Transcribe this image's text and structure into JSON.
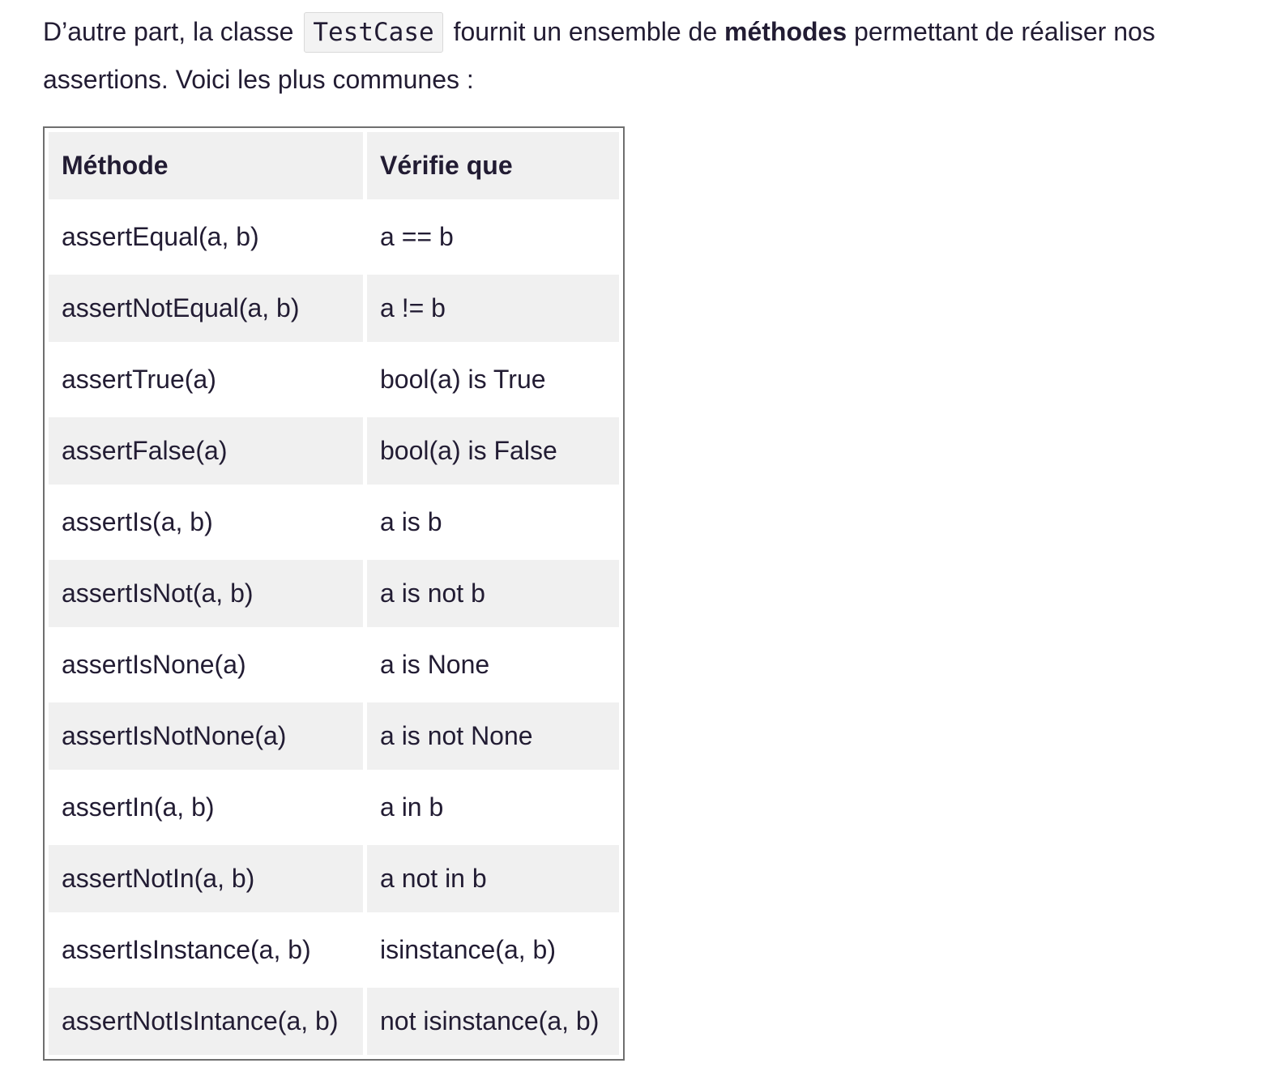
{
  "intro": {
    "part1": "D’autre part, la classe",
    "code": "TestCase",
    "part2": "fournit un ensemble de",
    "bold": "méthodes",
    "part3": "permettant de réaliser nos assertions. Voici les plus communes :"
  },
  "table": {
    "headers": [
      "Méthode",
      "Vérifie que"
    ],
    "rows": [
      [
        "assertEqual(a, b)",
        "a == b"
      ],
      [
        "assertNotEqual(a, b)",
        "a != b"
      ],
      [
        "assertTrue(a)",
        "bool(a) is True"
      ],
      [
        "assertFalse(a)",
        "bool(a) is False"
      ],
      [
        "assertIs(a, b)",
        "a is b"
      ],
      [
        "assertIsNot(a, b)",
        "a is not b"
      ],
      [
        "assertIsNone(a)",
        "a is None"
      ],
      [
        "assertIsNotNone(a)",
        "a is not None"
      ],
      [
        "assertIn(a, b)",
        "a in b"
      ],
      [
        "assertNotIn(a, b)",
        "a not in b"
      ],
      [
        "assertIsInstance(a, b)",
        "isinstance(a, b)"
      ],
      [
        "assertNotIsIntance(a, b)",
        "not isinstance(a, b)"
      ]
    ]
  }
}
